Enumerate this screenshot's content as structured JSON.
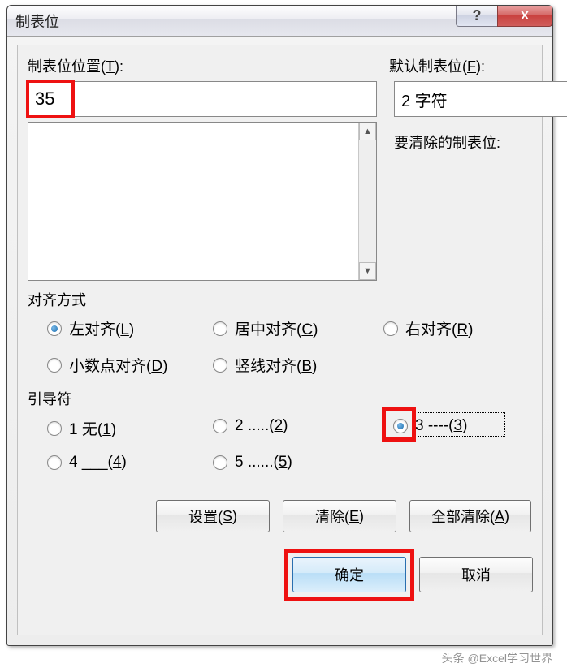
{
  "titlebar": {
    "title": "制表位",
    "help_symbol": "?",
    "close_symbol": "X"
  },
  "labels": {
    "tab_position": "制表位位置(T):",
    "tab_position_key": "T",
    "default_tab": "默认制表位(F):",
    "default_tab_key": "F",
    "to_clear": "要清除的制表位:",
    "alignment": "对齐方式",
    "leader": "引导符"
  },
  "fields": {
    "tab_position_value": "35",
    "default_tab_value": "2 字符"
  },
  "alignment": {
    "left": "左对齐(L)",
    "left_key": "L",
    "center": "居中对齐(C)",
    "center_key": "C",
    "right": "右对齐(R)",
    "right_key": "R",
    "decimal": "小数点对齐(D)",
    "decimal_key": "D",
    "bar": "竖线对齐(B)",
    "bar_key": "B",
    "selected": "left"
  },
  "leader": {
    "opt1": "1 无(1)",
    "opt1_key": "1",
    "opt2": "2 .....(2)",
    "opt2_key": "2",
    "opt3": "3 ----(3)",
    "opt3_key": "3",
    "opt4": "4 ___(4)",
    "opt4_key": "4",
    "opt5": "5 ......(5)",
    "opt5_key": "5",
    "selected": "3"
  },
  "buttons": {
    "set": "设置(S)",
    "set_key": "S",
    "clear": "清除(E)",
    "clear_key": "E",
    "clear_all": "全部清除(A)",
    "clear_all_key": "A",
    "ok": "确定",
    "cancel": "取消"
  },
  "watermark": "头条 @Excel学习世界"
}
